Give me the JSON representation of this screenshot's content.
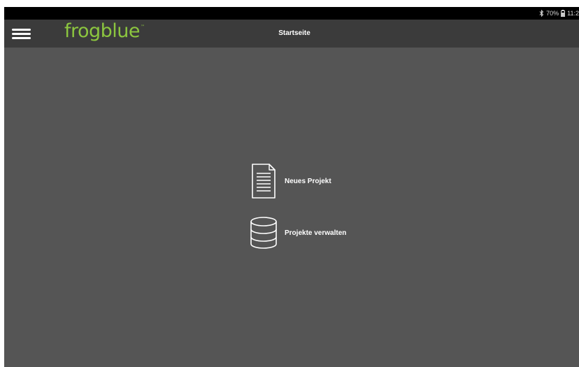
{
  "status_bar": {
    "battery": "70%",
    "time": "11:2",
    "icons": [
      "bluetooth-icon",
      "battery-icon"
    ]
  },
  "app_bar": {
    "logo": "frogblue",
    "logo_trademark": "™",
    "title": "Startseite",
    "menu_icon": "hamburger-menu-icon"
  },
  "main": {
    "actions": [
      {
        "label": "Neues Projekt",
        "icon": "document-icon"
      },
      {
        "label": "Projekte verwalten",
        "icon": "database-icon"
      }
    ]
  },
  "colors": {
    "background": "#555555",
    "app_bar": "#3b3b3b",
    "status_bar": "#000000",
    "brand_green": "#8cc63f",
    "text": "#ffffff"
  }
}
